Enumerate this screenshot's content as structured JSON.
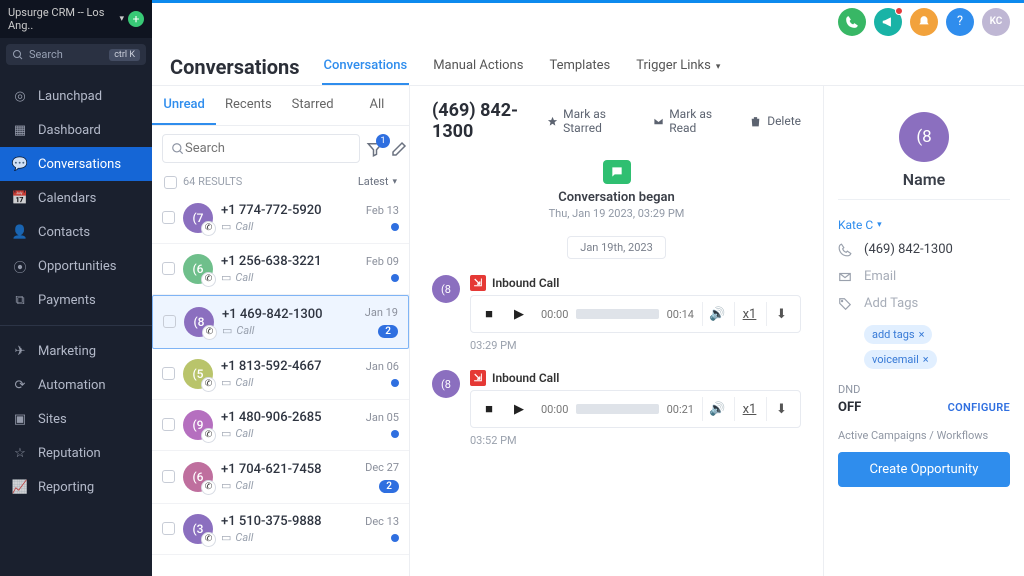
{
  "workspace": {
    "name": "Upsurge CRM -- Los Ang.."
  },
  "side_search_placeholder": "Search",
  "side_search_kbd": "ctrl K",
  "nav": [
    {
      "label": "Launchpad"
    },
    {
      "label": "Dashboard"
    },
    {
      "label": "Conversations",
      "active": true
    },
    {
      "label": "Calendars"
    },
    {
      "label": "Contacts"
    },
    {
      "label": "Opportunities"
    },
    {
      "label": "Payments"
    },
    {
      "label": "Marketing"
    },
    {
      "label": "Automation"
    },
    {
      "label": "Sites"
    },
    {
      "label": "Reputation"
    },
    {
      "label": "Reporting"
    }
  ],
  "page": {
    "title": "Conversations"
  },
  "subtabs": [
    {
      "label": "Conversations",
      "active": true
    },
    {
      "label": "Manual Actions"
    },
    {
      "label": "Templates"
    },
    {
      "label": "Trigger Links",
      "caret": true
    }
  ],
  "filter_tabs": [
    {
      "label": "Unread",
      "active": true
    },
    {
      "label": "Recents"
    },
    {
      "label": "Starred"
    },
    {
      "label": "All"
    }
  ],
  "list_search_placeholder": "Search",
  "filter_badge": "1",
  "results_text": "64 RESULTS",
  "sort_label": "Latest",
  "conversations": [
    {
      "initial": "(7",
      "color": "#8b6fbf",
      "phone": "+1 774-772-5920",
      "sub": "Call",
      "date": "Feb 13",
      "badge": null,
      "dot": true
    },
    {
      "initial": "(6",
      "color": "#6fbf8b",
      "phone": "+1 256-638-3221",
      "sub": "Call",
      "date": "Feb 09",
      "badge": null,
      "dot": true
    },
    {
      "initial": "(8",
      "color": "#8b6fbf",
      "phone": "+1 469-842-1300",
      "sub": "Call",
      "date": "Jan 19",
      "badge": "2",
      "selected": true
    },
    {
      "initial": "(5",
      "color": "#b9c46b",
      "phone": "+1 813-592-4667",
      "sub": "Call",
      "date": "Jan 06",
      "badge": null,
      "dot": true
    },
    {
      "initial": "(9",
      "color": "#b56fbf",
      "phone": "+1 480-906-2685",
      "sub": "Call",
      "date": "Jan 05",
      "badge": null,
      "dot": true
    },
    {
      "initial": "(6",
      "color": "#bf6f9e",
      "phone": "+1 704-621-7458",
      "sub": "Call",
      "date": "Dec 27",
      "badge": "2"
    },
    {
      "initial": "(3",
      "color": "#8b6fbf",
      "phone": "+1 510-375-9888",
      "sub": "Call",
      "date": "Dec 13",
      "badge": null,
      "dot": true
    }
  ],
  "thread": {
    "title": "(469) 842-1300",
    "actions": {
      "star": "Mark as Starred",
      "read": "Mark as Read",
      "delete": "Delete"
    },
    "began": {
      "label": "Conversation began",
      "ts": "Thu, Jan 19 2023, 03:29 PM"
    },
    "date_chip": "Jan 19th, 2023",
    "calls": [
      {
        "av": "(8",
        "label": "Inbound Call",
        "start": "00:00",
        "end": "00:14",
        "speed": "x1",
        "ts": "03:29 PM"
      },
      {
        "av": "(8",
        "label": "Inbound Call",
        "start": "00:00",
        "end": "00:21",
        "speed": "x1",
        "ts": "03:52 PM"
      }
    ]
  },
  "details": {
    "avatar": "(8",
    "name": "Name",
    "owner": "Kate C",
    "phone": "(469) 842-1300",
    "email_placeholder": "Email",
    "tags_placeholder": "Add Tags",
    "tags": [
      "add tags",
      "voicemail"
    ],
    "dnd_label": "DND",
    "dnd_value": "OFF",
    "dnd_configure": "CONFIGURE",
    "campaigns_label": "Active Campaigns / Workflows",
    "create_opp": "Create Opportunity"
  },
  "topbar_initials": "KC"
}
